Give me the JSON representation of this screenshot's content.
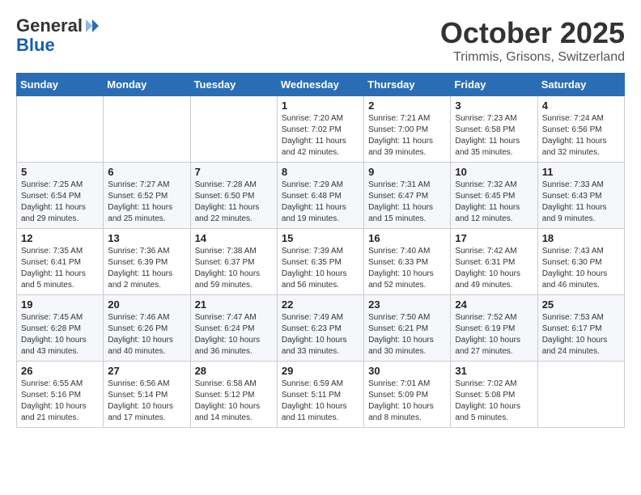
{
  "header": {
    "logo_general": "General",
    "logo_blue": "Blue",
    "month_title": "October 2025",
    "location": "Trimmis, Grisons, Switzerland"
  },
  "weekdays": [
    "Sunday",
    "Monday",
    "Tuesday",
    "Wednesday",
    "Thursday",
    "Friday",
    "Saturday"
  ],
  "weeks": [
    [
      {
        "day": "",
        "info": ""
      },
      {
        "day": "",
        "info": ""
      },
      {
        "day": "",
        "info": ""
      },
      {
        "day": "1",
        "info": "Sunrise: 7:20 AM\nSunset: 7:02 PM\nDaylight: 11 hours and 42 minutes."
      },
      {
        "day": "2",
        "info": "Sunrise: 7:21 AM\nSunset: 7:00 PM\nDaylight: 11 hours and 39 minutes."
      },
      {
        "day": "3",
        "info": "Sunrise: 7:23 AM\nSunset: 6:58 PM\nDaylight: 11 hours and 35 minutes."
      },
      {
        "day": "4",
        "info": "Sunrise: 7:24 AM\nSunset: 6:56 PM\nDaylight: 11 hours and 32 minutes."
      }
    ],
    [
      {
        "day": "5",
        "info": "Sunrise: 7:25 AM\nSunset: 6:54 PM\nDaylight: 11 hours and 29 minutes."
      },
      {
        "day": "6",
        "info": "Sunrise: 7:27 AM\nSunset: 6:52 PM\nDaylight: 11 hours and 25 minutes."
      },
      {
        "day": "7",
        "info": "Sunrise: 7:28 AM\nSunset: 6:50 PM\nDaylight: 11 hours and 22 minutes."
      },
      {
        "day": "8",
        "info": "Sunrise: 7:29 AM\nSunset: 6:48 PM\nDaylight: 11 hours and 19 minutes."
      },
      {
        "day": "9",
        "info": "Sunrise: 7:31 AM\nSunset: 6:47 PM\nDaylight: 11 hours and 15 minutes."
      },
      {
        "day": "10",
        "info": "Sunrise: 7:32 AM\nSunset: 6:45 PM\nDaylight: 11 hours and 12 minutes."
      },
      {
        "day": "11",
        "info": "Sunrise: 7:33 AM\nSunset: 6:43 PM\nDaylight: 11 hours and 9 minutes."
      }
    ],
    [
      {
        "day": "12",
        "info": "Sunrise: 7:35 AM\nSunset: 6:41 PM\nDaylight: 11 hours and 5 minutes."
      },
      {
        "day": "13",
        "info": "Sunrise: 7:36 AM\nSunset: 6:39 PM\nDaylight: 11 hours and 2 minutes."
      },
      {
        "day": "14",
        "info": "Sunrise: 7:38 AM\nSunset: 6:37 PM\nDaylight: 10 hours and 59 minutes."
      },
      {
        "day": "15",
        "info": "Sunrise: 7:39 AM\nSunset: 6:35 PM\nDaylight: 10 hours and 56 minutes."
      },
      {
        "day": "16",
        "info": "Sunrise: 7:40 AM\nSunset: 6:33 PM\nDaylight: 10 hours and 52 minutes."
      },
      {
        "day": "17",
        "info": "Sunrise: 7:42 AM\nSunset: 6:31 PM\nDaylight: 10 hours and 49 minutes."
      },
      {
        "day": "18",
        "info": "Sunrise: 7:43 AM\nSunset: 6:30 PM\nDaylight: 10 hours and 46 minutes."
      }
    ],
    [
      {
        "day": "19",
        "info": "Sunrise: 7:45 AM\nSunset: 6:28 PM\nDaylight: 10 hours and 43 minutes."
      },
      {
        "day": "20",
        "info": "Sunrise: 7:46 AM\nSunset: 6:26 PM\nDaylight: 10 hours and 40 minutes."
      },
      {
        "day": "21",
        "info": "Sunrise: 7:47 AM\nSunset: 6:24 PM\nDaylight: 10 hours and 36 minutes."
      },
      {
        "day": "22",
        "info": "Sunrise: 7:49 AM\nSunset: 6:23 PM\nDaylight: 10 hours and 33 minutes."
      },
      {
        "day": "23",
        "info": "Sunrise: 7:50 AM\nSunset: 6:21 PM\nDaylight: 10 hours and 30 minutes."
      },
      {
        "day": "24",
        "info": "Sunrise: 7:52 AM\nSunset: 6:19 PM\nDaylight: 10 hours and 27 minutes."
      },
      {
        "day": "25",
        "info": "Sunrise: 7:53 AM\nSunset: 6:17 PM\nDaylight: 10 hours and 24 minutes."
      }
    ],
    [
      {
        "day": "26",
        "info": "Sunrise: 6:55 AM\nSunset: 5:16 PM\nDaylight: 10 hours and 21 minutes."
      },
      {
        "day": "27",
        "info": "Sunrise: 6:56 AM\nSunset: 5:14 PM\nDaylight: 10 hours and 17 minutes."
      },
      {
        "day": "28",
        "info": "Sunrise: 6:58 AM\nSunset: 5:12 PM\nDaylight: 10 hours and 14 minutes."
      },
      {
        "day": "29",
        "info": "Sunrise: 6:59 AM\nSunset: 5:11 PM\nDaylight: 10 hours and 11 minutes."
      },
      {
        "day": "30",
        "info": "Sunrise: 7:01 AM\nSunset: 5:09 PM\nDaylight: 10 hours and 8 minutes."
      },
      {
        "day": "31",
        "info": "Sunrise: 7:02 AM\nSunset: 5:08 PM\nDaylight: 10 hours and 5 minutes."
      },
      {
        "day": "",
        "info": ""
      }
    ]
  ]
}
